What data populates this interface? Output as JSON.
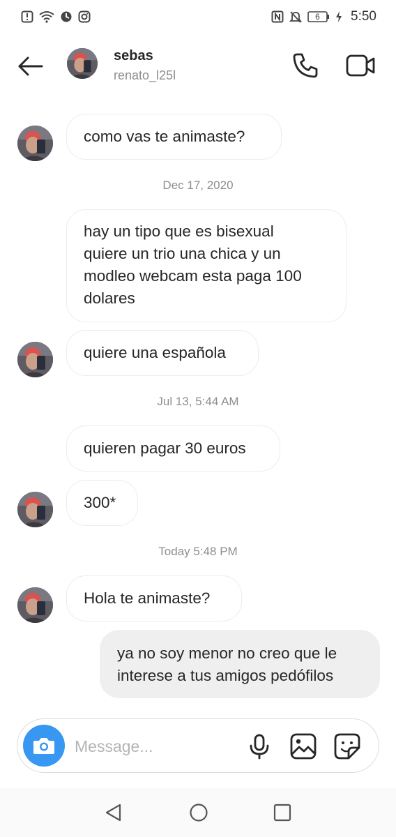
{
  "status_bar": {
    "time": "5:50",
    "battery": "6",
    "icons_left": [
      "alert-icon",
      "wifi-icon",
      "data-saver-icon",
      "instagram-icon"
    ],
    "icons_right": [
      "nfc-icon",
      "mute-icon",
      "battery-icon",
      "charging-icon"
    ]
  },
  "header": {
    "name": "sebas",
    "username": "renato_l25l"
  },
  "messages": [
    {
      "from": "them",
      "text": "como vas te animaste?",
      "avatar": true
    },
    {
      "type": "timestamp",
      "text": "Dec 17, 2020"
    },
    {
      "from": "them",
      "text": "hay un tipo que es bisexual\nquiere un trio una chica y un\nmodleo webcam esta paga 100\ndolares",
      "avatar": false
    },
    {
      "from": "them",
      "text": "quiere una española",
      "avatar": true
    },
    {
      "type": "timestamp",
      "text": "Jul 13, 5:44 AM"
    },
    {
      "from": "them",
      "text": "quieren pagar 30 euros",
      "avatar": false
    },
    {
      "from": "them",
      "text": "300*",
      "avatar": true
    },
    {
      "type": "timestamp",
      "text": "Today 5:48 PM"
    },
    {
      "from": "them",
      "text": "Hola te animaste?",
      "avatar": true
    },
    {
      "from": "me",
      "text": "ya no soy menor no creo que le\ninterese a tus amigos pedófilos"
    }
  ],
  "composer": {
    "placeholder": "Message..."
  },
  "colors": {
    "accent": "#3897f0",
    "bubble_border": "#ececec",
    "my_bubble": "#efefef",
    "timestamp": "#8e8e8e"
  }
}
